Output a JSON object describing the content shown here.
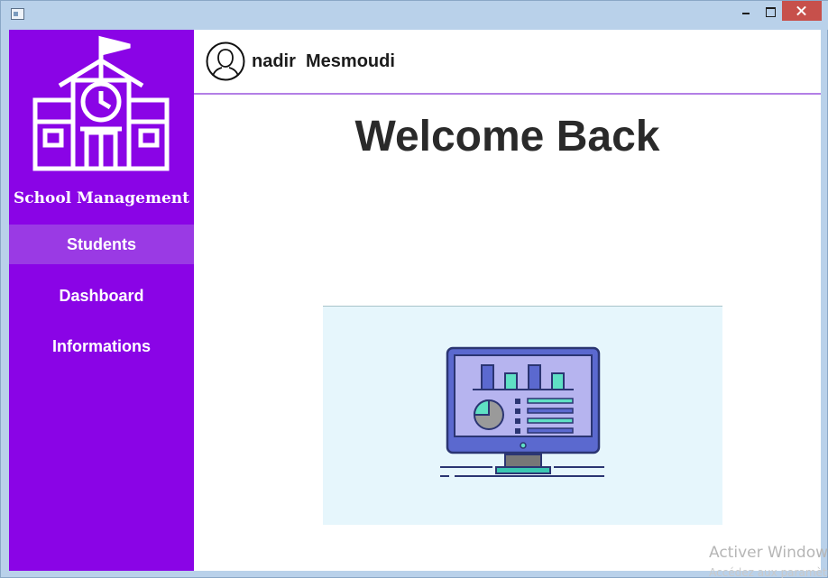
{
  "window": {
    "icon": "app-window-icon",
    "controls": [
      "minimize-icon",
      "maximize-icon",
      "close-icon"
    ],
    "close_color": "#c7504b"
  },
  "sidebar": {
    "brand": "School Management",
    "logo_icon": "school-building-icon",
    "background": "#8a04e6",
    "items": [
      {
        "label": "Students",
        "selected": true
      },
      {
        "label": "Dashboard",
        "selected": false
      },
      {
        "label": "Informations",
        "selected": false
      }
    ],
    "selected_background": "#9a3ae4"
  },
  "header": {
    "avatar_icon": "user-avatar-icon",
    "user_name": "nadir  Mesmoudi",
    "accent_line": "#b37fe6"
  },
  "main": {
    "title": "Welcome Back",
    "illustration_icon": "dashboard-monitor-icon",
    "illustration_background": "#e6f6fc"
  },
  "watermark": {
    "line1": "Activer Windows",
    "line2": "Accédez aux paramètres"
  }
}
